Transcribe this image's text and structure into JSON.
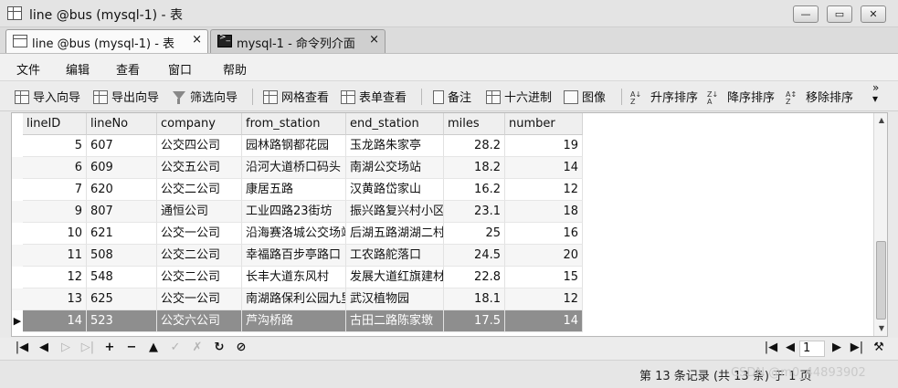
{
  "window": {
    "title": "line @bus (mysql-1) - 表",
    "controls": [
      "—",
      "▭",
      "✕"
    ]
  },
  "tabs": [
    {
      "label": "line @bus (mysql-1) - 表",
      "icon": "table-grid-icon",
      "close": "×"
    },
    {
      "label": "mysql-1 - 命令列介面",
      "icon": "terminal-icon",
      "close": "×"
    }
  ],
  "menu": [
    "文件",
    "编辑",
    "查看",
    "窗口",
    "帮助"
  ],
  "toolbar": {
    "import_wizard": "导入向导",
    "export_wizard": "导出向导",
    "filter_wizard": "筛选向导",
    "grid_view": "网格查看",
    "form_view": "表单查看",
    "note": "备注",
    "hex": "十六进制",
    "image": "图像",
    "sort_asc": "升序排序",
    "sort_desc": "降序排序",
    "remove_sort": "移除排序",
    "more": "»"
  },
  "table": {
    "columns": [
      "lineID",
      "lineNo",
      "company",
      "from_station",
      "end_station",
      "miles",
      "number"
    ],
    "rows": [
      [
        "5",
        "607",
        "公交四公司",
        "园林路钢都花园",
        "玉龙路朱家亭",
        "28.2",
        "19"
      ],
      [
        "6",
        "609",
        "公交五公司",
        "沿河大道桥口码头",
        "南湖公交场站",
        "18.2",
        "14"
      ],
      [
        "7",
        "620",
        "公交二公司",
        "康居五路",
        "汉黄路岱家山",
        "16.2",
        "12"
      ],
      [
        "9",
        "807",
        "通恒公司",
        "工业四路23街坊",
        "振兴路复兴村小区",
        "23.1",
        "18"
      ],
      [
        "10",
        "621",
        "公交一公司",
        "沿海赛洛城公交场站",
        "后湖五路湖湖二村",
        "25",
        "16"
      ],
      [
        "11",
        "508",
        "公交二公司",
        "幸福路百步亭路口",
        "工农路舵落口",
        "24.5",
        "20"
      ],
      [
        "12",
        "548",
        "公交二公司",
        "长丰大道东风村",
        "发展大道红旗建材",
        "22.8",
        "15"
      ],
      [
        "13",
        "625",
        "公交一公司",
        "南湖路保利公园九里",
        "武汉植物园",
        "18.1",
        "12"
      ],
      [
        "14",
        "523",
        "公交六公司",
        "芦沟桥路",
        "古田二路陈家墩",
        "17.5",
        "14"
      ]
    ],
    "selected_row_marker": "▶"
  },
  "navigator": {
    "first": "|◀",
    "prev": "◀",
    "next": "▷",
    "last": "▷|",
    "add": "+",
    "delete": "−",
    "up": "▲",
    "apply": "✓",
    "cancel": "✗",
    "refresh": "↻",
    "stop": "⊘",
    "page_first": "|◀",
    "page_prev": "◀",
    "page_value": "1",
    "page_next": "▶",
    "page_last": "▶|",
    "settings": "⚒"
  },
  "status": {
    "record_info": "第 13 条记录 (共 13 条) 于 1 页",
    "watermark": "CSDN @m0_44893902"
  }
}
